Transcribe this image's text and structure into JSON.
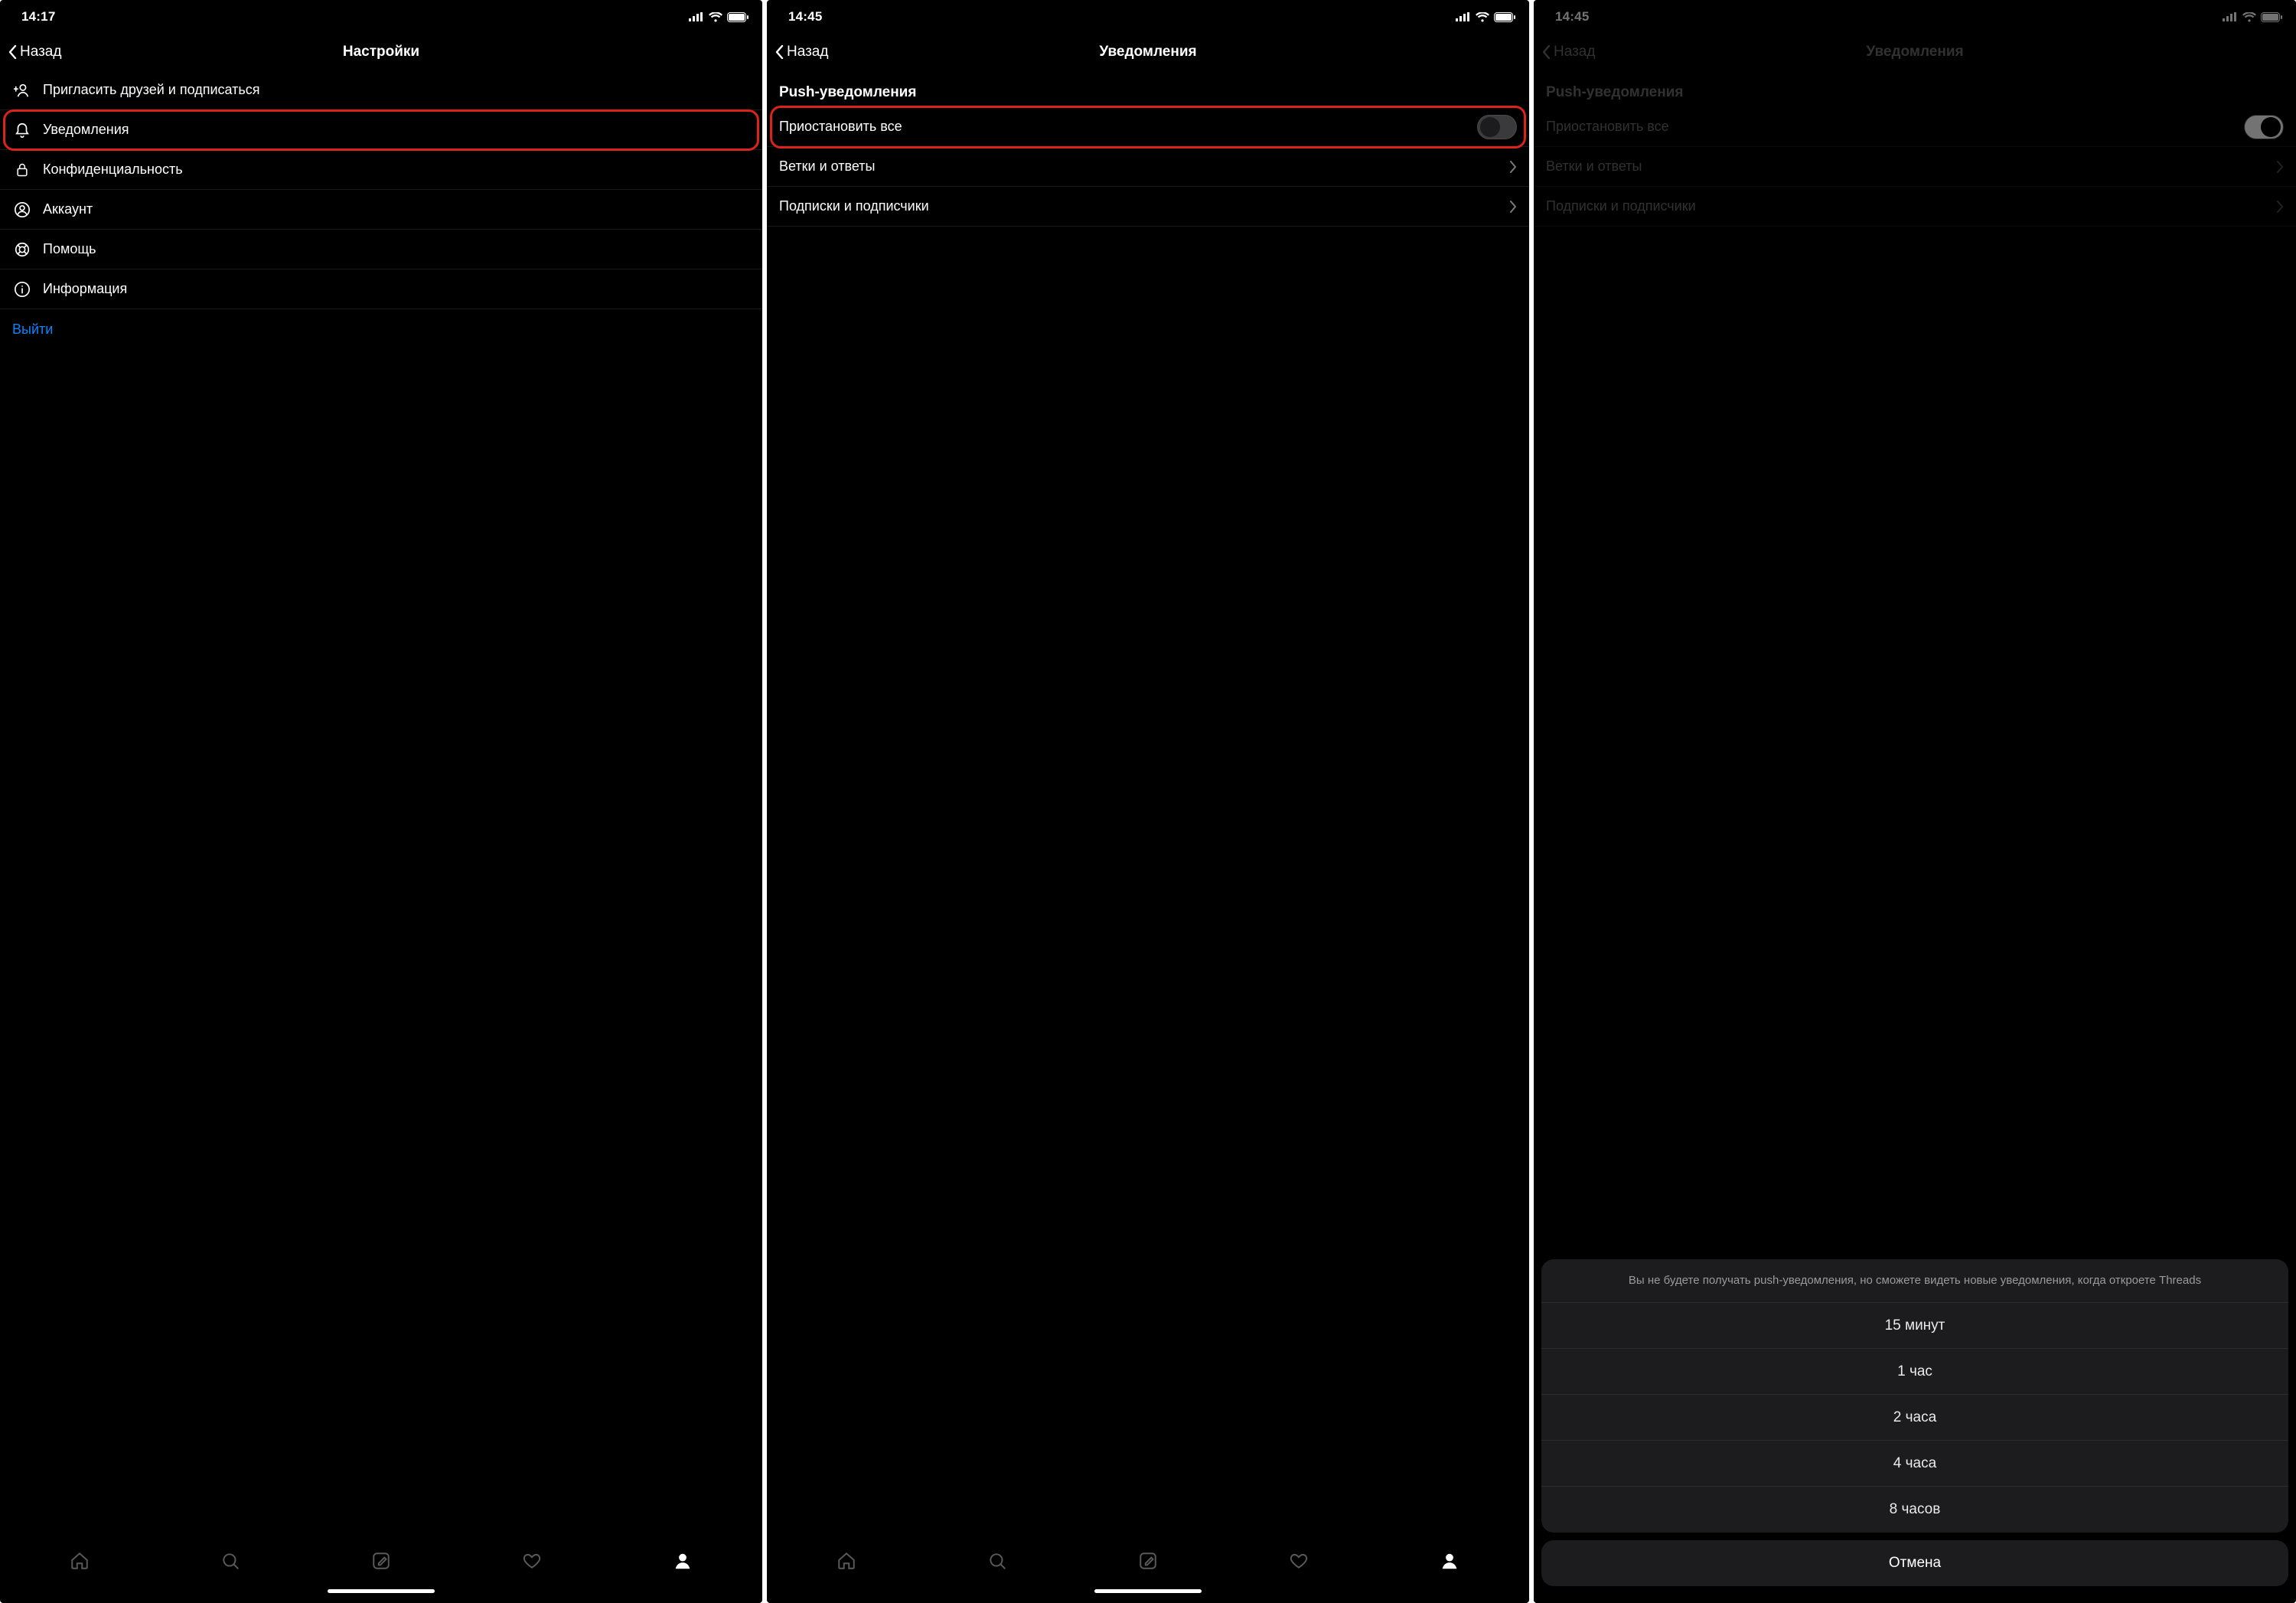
{
  "screen1": {
    "time": "14:17",
    "back": "Назад",
    "title": "Настройки",
    "items": [
      {
        "icon": "person-add-icon",
        "label": "Пригласить друзей и подписаться"
      },
      {
        "icon": "bell-icon",
        "label": "Уведомления"
      },
      {
        "icon": "lock-icon",
        "label": "Конфиденциальность"
      },
      {
        "icon": "account-icon",
        "label": "Аккаунт"
      },
      {
        "icon": "help-icon",
        "label": "Помощь"
      },
      {
        "icon": "info-icon",
        "label": "Информация"
      }
    ],
    "logout": "Выйти",
    "highlight_index": 1
  },
  "screen2": {
    "time": "14:45",
    "back": "Назад",
    "title": "Уведомления",
    "section_header": "Push-уведомления",
    "rows": {
      "pause_all": "Приостановить все",
      "threads_replies": "Ветки и ответы",
      "follows": "Подписки и подписчики"
    },
    "pause_all_on": false,
    "highlight_row": "pause_all"
  },
  "screen3": {
    "time": "14:45",
    "back": "Назад",
    "title": "Уведомления",
    "section_header": "Push-уведомления",
    "rows": {
      "pause_all": "Приостановить все",
      "threads_replies": "Ветки и ответы",
      "follows": "Подписки и подписчики"
    },
    "pause_all_on": true,
    "sheet": {
      "message": "Вы не будете получать push-уведомления, но сможете видеть новые уведомления, когда откроете Threads",
      "options": [
        "15 минут",
        "1 час",
        "2 часа",
        "4 часа",
        "8 часов"
      ],
      "cancel": "Отмена"
    }
  }
}
